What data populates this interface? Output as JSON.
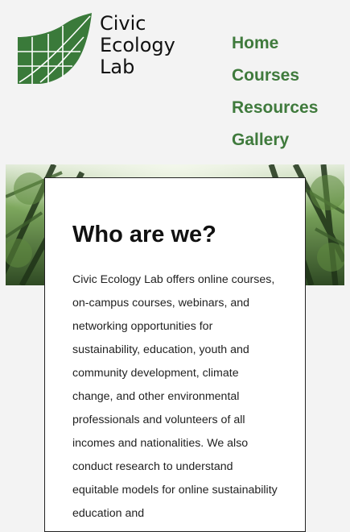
{
  "logo": {
    "line1": "Civic",
    "line2": "Ecology",
    "line3": "Lab"
  },
  "nav": {
    "items": [
      "Home",
      "Courses",
      "Resources",
      "Gallery"
    ]
  },
  "about": {
    "heading": "Who are we?",
    "body": "Civic Ecology Lab offers online courses, on-campus courses, webinars, and networking opportunities for sustainability, education, youth and community development, climate change, and other environmental professionals and volunteers of all incomes and nationalities. We also conduct research to understand equitable models for online sustainability education and"
  },
  "colors": {
    "brand_green": "#3f7a3c",
    "logo_green": "#3a7a3a",
    "page_bg": "#f3f3f3"
  }
}
